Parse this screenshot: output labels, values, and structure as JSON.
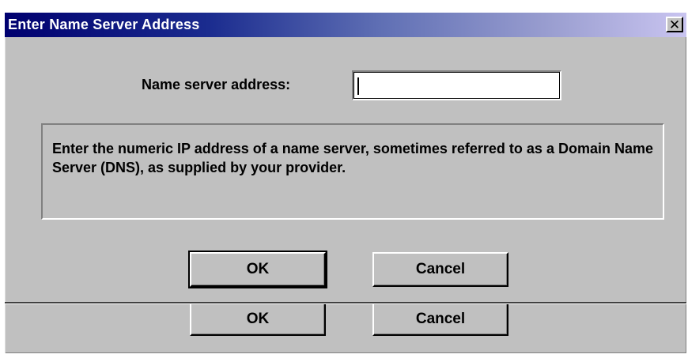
{
  "window": {
    "title": "Enter Name Server Address",
    "close_icon": "close-icon"
  },
  "form": {
    "label": "Name server address:",
    "input_value": "",
    "input_placeholder": ""
  },
  "info": {
    "text": "Enter the numeric IP address of a name server, sometimes referred to as a Domain Name Server (DNS), as supplied by your provider."
  },
  "buttons": {
    "ok_label": "OK",
    "cancel_label": "Cancel"
  },
  "duplicate_buttons": {
    "ok_label": "OK",
    "cancel_label": "Cancel"
  },
  "colors": {
    "dialog_bg": "#c0c0c0",
    "titlebar_start": "#00006f",
    "titlebar_end": "#c9c4f0",
    "title_text": "#ffffff"
  }
}
